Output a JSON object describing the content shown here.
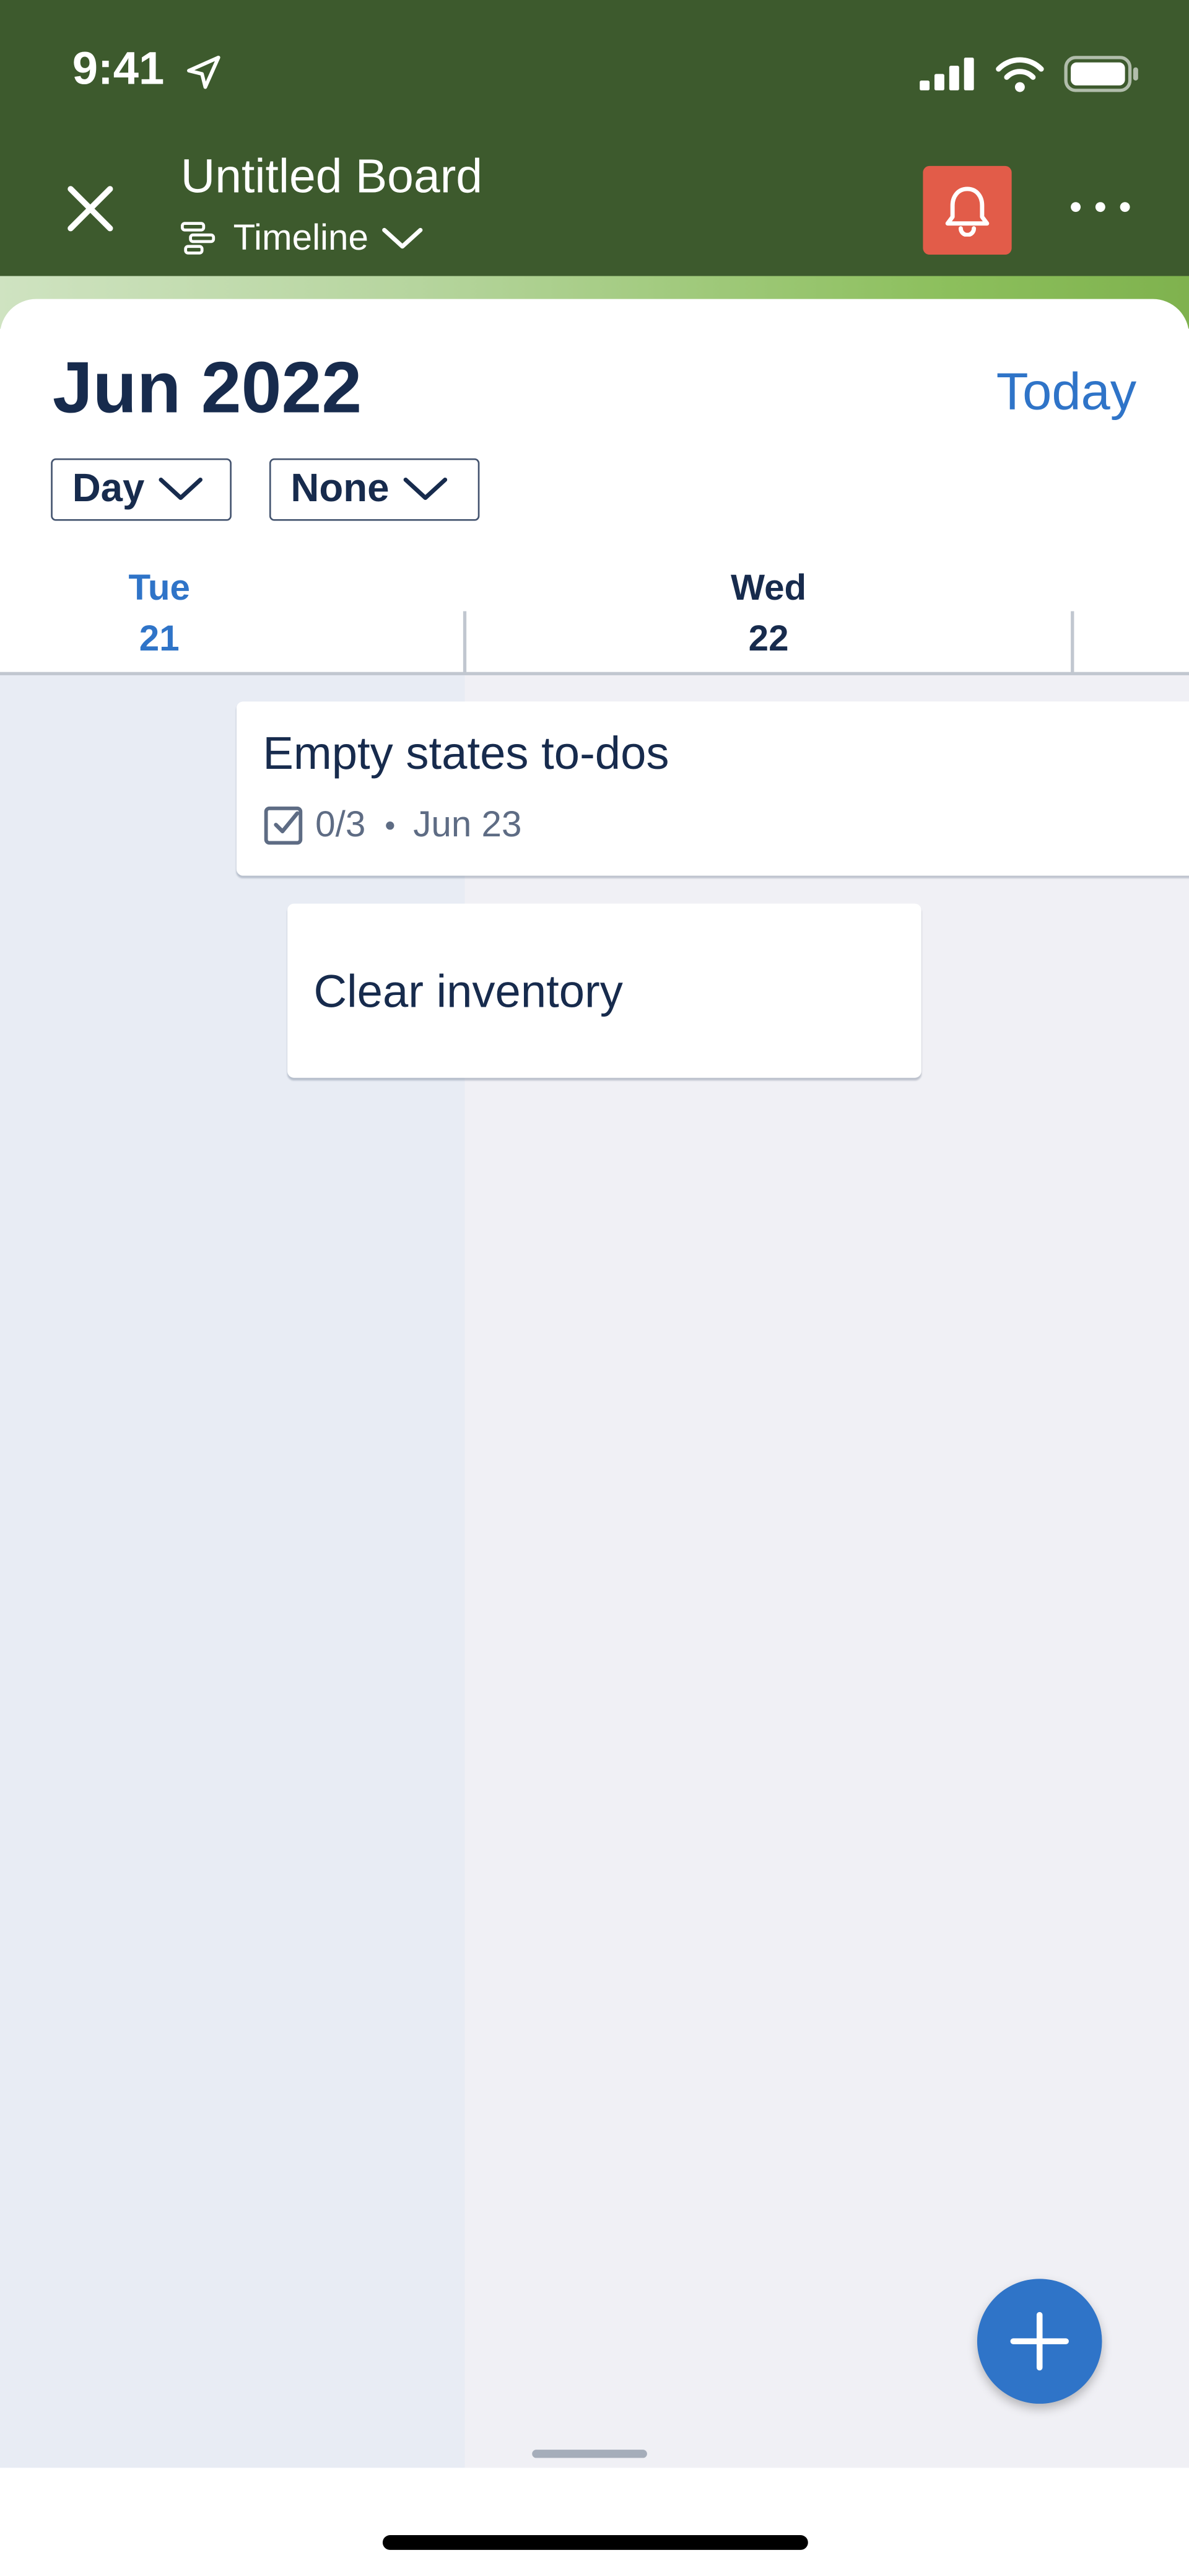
{
  "status_bar": {
    "time": "9:41"
  },
  "header": {
    "board_title": "Untitled Board",
    "view_label": "Timeline",
    "colors": {
      "background": "#3d5a2d",
      "notification_button": "#e25c49"
    },
    "icons": [
      "close-icon",
      "timeline-icon",
      "chevron-down-icon",
      "bell-icon",
      "more-icon"
    ]
  },
  "calendar": {
    "month_label": "Jun 2022",
    "today_label": "Today",
    "zoom_dropdown": "Day",
    "group_dropdown": "None",
    "days": [
      {
        "weekday": "Tue",
        "date": "21",
        "is_today": true
      },
      {
        "weekday": "Wed",
        "date": "22",
        "is_today": false
      }
    ],
    "accent_color": "#2f74c8"
  },
  "cards": [
    {
      "title": "Empty states to-dos",
      "checklist": "0/3",
      "due": "Jun 23"
    },
    {
      "title": "Clear inventory"
    }
  ],
  "fab": {
    "icon": "plus-icon"
  }
}
